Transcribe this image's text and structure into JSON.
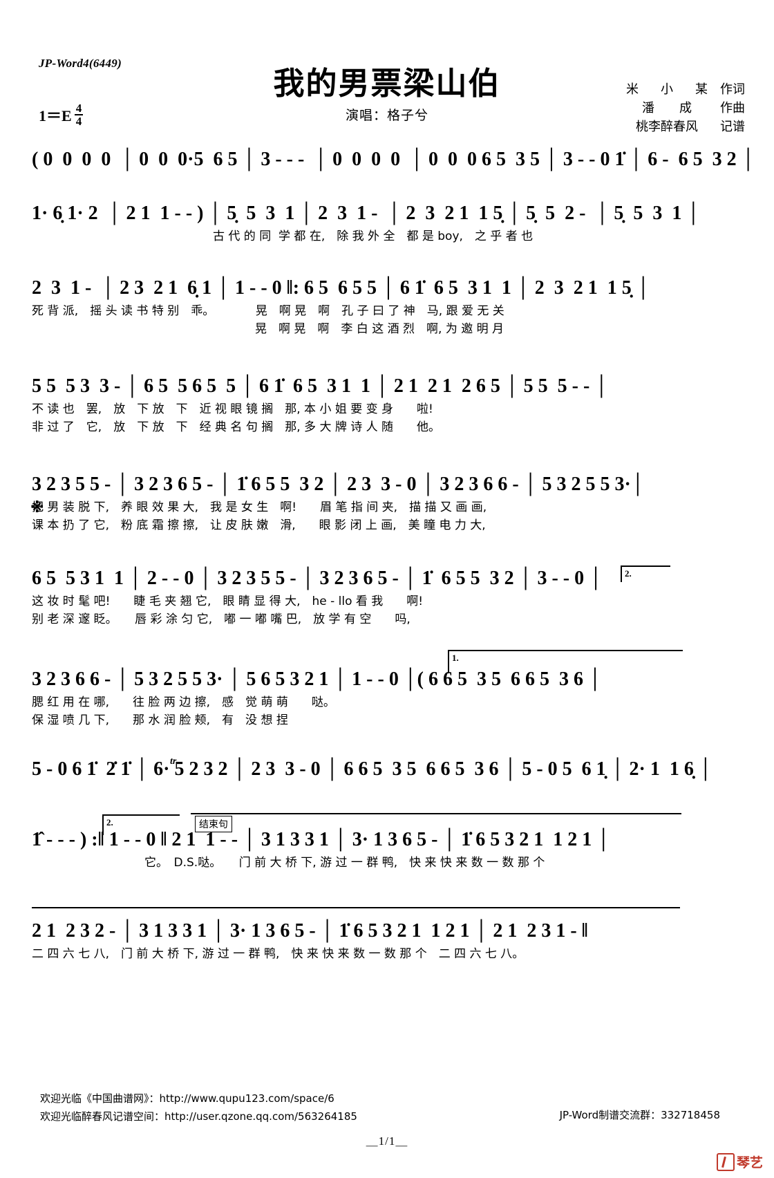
{
  "meta": {
    "watermark": "JP-Word4(6449)",
    "title": "我的男票梁山伯",
    "singer_line": "演唱：格子兮",
    "key_label": "1＝E",
    "time_num": "4",
    "time_den": "4"
  },
  "credits": {
    "lyricist_name": "米 小 某",
    "lyricist_role": "作词",
    "composer_name": "潘　　成",
    "composer_role": "作曲",
    "transcriber_name": "桃李醉春风",
    "transcriber_role": "记谱"
  },
  "score": {
    "systems": [
      {
        "id": "system-1",
        "notes": "( 0  0  0  0  │ 0  0  0·5  6 5 │ 3 - - -  │ 0  0  0  0  │ 0  0  0 6 5  3 5 │ 3 - - 0 1̇ │ 6 -  6 5  3 2 │",
        "lyrics": []
      },
      {
        "id": "system-2",
        "notes": "1· 6̣ 1· 2  │ 2 1  1 - - ) │ 5̣  5  3  1 │ 2  3  1 -  │ 2  3  2 1  1 5̣ │ 5̣  5  2 -  │ 5̣  5  3  1 │",
        "lyrics": [
          "古 代 的 同  学 都 在,　除 我 外 全　都 是 boy,　之 乎 者 也"
        ]
      },
      {
        "id": "system-3",
        "notes": "2  3  1 -  │ 2 3  2 1  6̣ 1 │ 1 - - 0 ‖: 6 5  6 5 5 │ 6 1̇  6 5  3 1  1 │ 2  3  2 1  1 5̣ │",
        "lyrics": [
          "死 背 派,　摇 头 读 书 特 别　乖。　　　　晃　啊 晃　啊　孔 子 曰 了 神　马, 跟 爱 无 关",
          "　　　　　　　　　　　　　　　　　　　晃　啊 晃　啊　李 白 这 酒 烈　啊, 为 邀 明 月"
        ]
      },
      {
        "id": "system-4",
        "notes": "5 5  5 3  3 - │ 6 5  5 6 5  5 │ 6 1̇  6 5  3 1  1 │ 2 1  2 1  2 6 5 │ 5 5  5 - - │",
        "lyrics": [
          "不 读 也　罢,　放　下 放　下　近 视 眼 镜 搁　那, 本 小 姐 要 变 身　　啦!",
          "非 过 了　它,　放　下 放　下　经 典 名 句 搁　那, 多 大 牌 诗 人 随　　他。"
        ]
      },
      {
        "id": "system-5",
        "notes": "3 2 3 5 5 - │ 3 2 3 6 5 - │ 1̇ 6 5 5  3 2 │ 2 3  3 - 0 │ 3 2 3 6 6 - │ 5 3 2 5 5 3·│",
        "lyrics": [
          "把 男 装 脱 下,　养 眼 效 果 大,　我 是 女 生　啊!　　眉 笔 指 间 夹,　描 描 又 画 画,",
          "课 本 扔 了 它,　粉 底 霜 擦 擦,　让 皮 肤 嫩　滑,　　眼 影 闭 上 画,　美 瞳 电 力 大,"
        ]
      },
      {
        "id": "system-6",
        "notes": "6 5  5 3 1  1 │ 2 - - 0 │ 3 2 3 5 5 - │ 3 2 3 6 5 - │ 1̇  6 5 5  3 2 │ 3 - - 0 │",
        "lyrics": [
          "这 妆 时 髦 吧!　　睫 毛 夹 翘 它,　眼 睛 显 得 大,　he - llo 看 我　　啊!",
          "别 老 深 邃 眨。　　唇 彩 涂 匀 它,　嘟 一 嘟 嘴 巴,　放 学 有 空　　吗,"
        ]
      },
      {
        "id": "system-7",
        "notes": "3 2 3 6 6 - │ 5 3 2 5 5 3· │ 5 6 5 3 2 1 │ 1 - - 0 │( 6 6 5  3 5  6 6 5  3 6 │",
        "lyrics": [
          "腮 红 用 在 哪,　　往 脸 两 边 擦,　感　觉 萌 萌　　哒。",
          "保 湿 喷 几 下,　　那 水 润 脸 颊,　有　没 想 捏"
        ]
      },
      {
        "id": "system-8",
        "notes": "5 - 0 6 1̇  2̇ 1̇ │ 6· 5 2 3 2 │ 2 3  3 - 0 │ 6 6 5  3 5  6 6 5  3 6 │ 5 - 0 5  6 1̣ │ 2· 1  1 6̣ │",
        "lyrics": []
      },
      {
        "id": "system-9",
        "notes": "1̂ - - - ) :‖ 1 - - 0 ‖ 2 1  1 - - │ 3 1 3 3 1 │ 3· 1 3 6 5 - │ 1̇ 6 5 3 2 1  1 2 1 │",
        "lyrics": [
          "　　　它。　D.S.哒。　　门 前 大 桥 下, 游 过 一 群 鸭,　快 来 快 来 数 一 数 那 个"
        ]
      },
      {
        "id": "system-10",
        "notes": "2 1  2 3 2 - │ 3 1 3 3 1 │ 3· 1 3 6 5 - │ 1̇ 6 5 3 2 1  1 2 1 │ 2 1  2 3 1 - ‖",
        "lyrics": [
          "二 四 六 七 八,　门 前 大 桥 下, 游 过 一 群 鸭,　快 来 快 来 数 一 数 那 个　二 四 六 七 八。"
        ]
      }
    ],
    "marks": {
      "segno": "※",
      "first_ending": "1.",
      "second_ending": "2.",
      "ending_phrase_label": "结束句",
      "trill": "tr",
      "ds_al": "D.S."
    }
  },
  "footer": {
    "line1": "欢迎光临《中国曲谱网》：http://www.qupu123.com/space/6",
    "line2": "欢迎光临醉春风记谱空间：http://user.qzone.qq.com/563264185",
    "group": "JP-Word制谱交流群：332718458",
    "page": "＿1/1＿",
    "logo_text": "琴艺"
  },
  "colors": {
    "ink": "#000000",
    "logo_red": "#c0392b",
    "paper": "#ffffff"
  }
}
